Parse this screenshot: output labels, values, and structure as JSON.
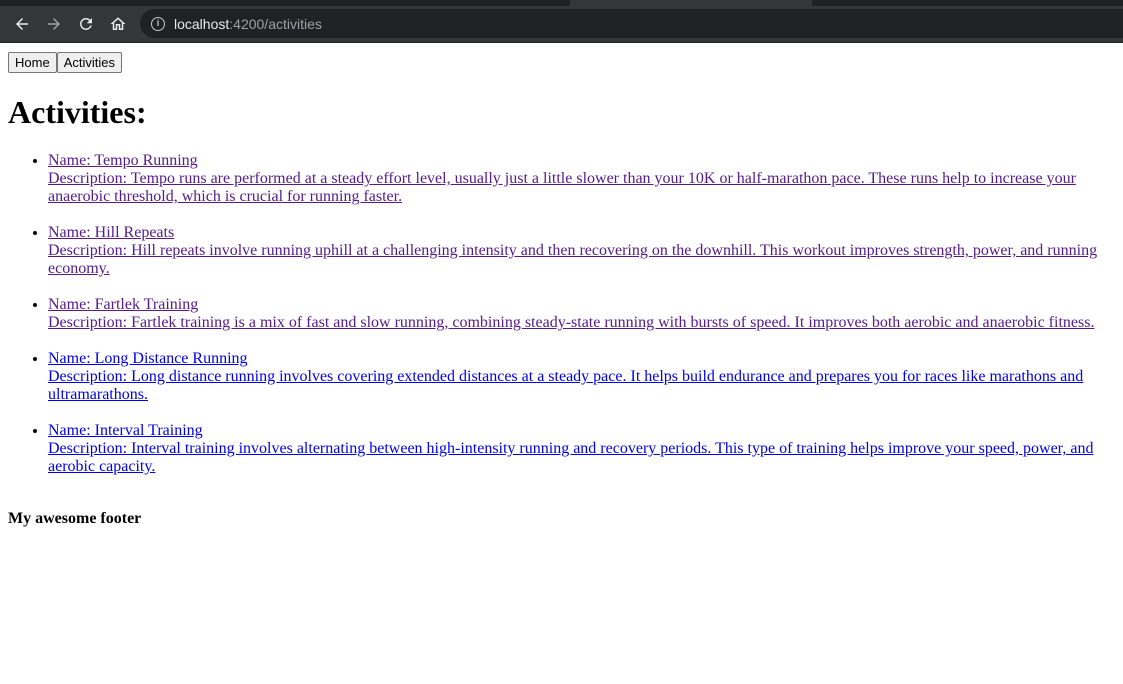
{
  "browser": {
    "url_host": "localhost",
    "url_rest": ":4200/activities"
  },
  "nav": {
    "home_label": "Home",
    "activities_label": "Activities"
  },
  "page_title": "Activities:",
  "activities": [
    {
      "name": "Name: Tempo Running",
      "description": "Description: Tempo runs are performed at a steady effort level, usually just a little slower than your 10K or half-marathon pace. These runs help to increase your anaerobic threshold, which is crucial for running faster.",
      "visited": true
    },
    {
      "name": "Name: Hill Repeats",
      "description": "Description: Hill repeats involve running uphill at a challenging intensity and then recovering on the downhill. This workout improves strength, power, and running economy.",
      "visited": true
    },
    {
      "name": "Name: Fartlek Training",
      "description": "Description: Fartlek training is a mix of fast and slow running, combining steady-state running with bursts of speed. It improves both aerobic and anaerobic fitness.",
      "visited": true
    },
    {
      "name": "Name: Long Distance Running",
      "description": "Description: Long distance running involves covering extended distances at a steady pace. It helps build endurance and prepares you for races like marathons and ultramarathons.",
      "visited": false
    },
    {
      "name": "Name: Interval Training",
      "description": "Description: Interval training involves alternating between high-intensity running and recovery periods. This type of training helps improve your speed, power, and aerobic capacity.",
      "visited": false
    }
  ],
  "footer": "My awesome footer",
  "colors": {
    "link": "#0000ee",
    "visited_link": "#551a8b",
    "chrome_bg": "#35363a"
  }
}
